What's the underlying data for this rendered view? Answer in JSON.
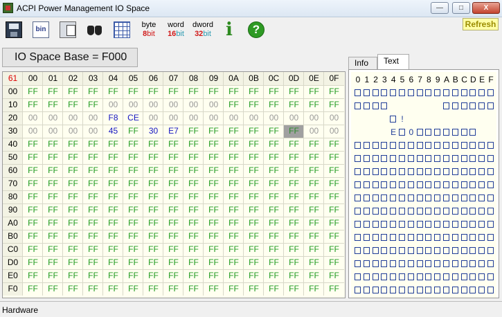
{
  "window": {
    "title": "ACPI Power Management IO Space",
    "minimize": "—",
    "maximize": "□",
    "close": "X"
  },
  "toolbar": {
    "bin_label": "bin",
    "byte": {
      "top": "byte",
      "num": "8",
      "unit": "bit"
    },
    "word": {
      "top": "word",
      "num": "16",
      "unit": "bit"
    },
    "dword": {
      "top": "dword",
      "num": "32",
      "unit": "bit"
    },
    "info_glyph": "i",
    "help_glyph": "?",
    "refresh": "Refresh"
  },
  "base_label": "IO Space Base = F000",
  "hex": {
    "corner": "61",
    "columns": [
      "00",
      "01",
      "02",
      "03",
      "04",
      "05",
      "06",
      "07",
      "08",
      "09",
      "0A",
      "0B",
      "0C",
      "0D",
      "0E",
      "0F"
    ],
    "rows": [
      {
        "addr": "00",
        "cells": [
          "FF",
          "FF",
          "FF",
          "FF",
          "FF",
          "FF",
          "FF",
          "FF",
          "FF",
          "FF",
          "FF",
          "FF",
          "FF",
          "FF",
          "FF",
          "FF"
        ]
      },
      {
        "addr": "10",
        "cells": [
          "FF",
          "FF",
          "FF",
          "FF",
          "00",
          "00",
          "00",
          "00",
          "00",
          "00",
          "FF",
          "FF",
          "FF",
          "FF",
          "FF",
          "FF"
        ]
      },
      {
        "addr": "20",
        "cells": [
          "00",
          "00",
          "00",
          "00",
          "F8",
          "CE",
          "00",
          "00",
          "00",
          "00",
          "00",
          "00",
          "00",
          "00",
          "00",
          "00"
        ]
      },
      {
        "addr": "30",
        "cells": [
          "00",
          "00",
          "00",
          "00",
          "45",
          "FF",
          "30",
          "E7",
          "FF",
          "FF",
          "FF",
          "FF",
          "FF",
          "FF",
          "00",
          "00"
        ]
      },
      {
        "addr": "40",
        "cells": [
          "FF",
          "FF",
          "FF",
          "FF",
          "FF",
          "FF",
          "FF",
          "FF",
          "FF",
          "FF",
          "FF",
          "FF",
          "FF",
          "FF",
          "FF",
          "FF"
        ]
      },
      {
        "addr": "50",
        "cells": [
          "FF",
          "FF",
          "FF",
          "FF",
          "FF",
          "FF",
          "FF",
          "FF",
          "FF",
          "FF",
          "FF",
          "FF",
          "FF",
          "FF",
          "FF",
          "FF"
        ]
      },
      {
        "addr": "60",
        "cells": [
          "FF",
          "FF",
          "FF",
          "FF",
          "FF",
          "FF",
          "FF",
          "FF",
          "FF",
          "FF",
          "FF",
          "FF",
          "FF",
          "FF",
          "FF",
          "FF"
        ]
      },
      {
        "addr": "70",
        "cells": [
          "FF",
          "FF",
          "FF",
          "FF",
          "FF",
          "FF",
          "FF",
          "FF",
          "FF",
          "FF",
          "FF",
          "FF",
          "FF",
          "FF",
          "FF",
          "FF"
        ]
      },
      {
        "addr": "80",
        "cells": [
          "FF",
          "FF",
          "FF",
          "FF",
          "FF",
          "FF",
          "FF",
          "FF",
          "FF",
          "FF",
          "FF",
          "FF",
          "FF",
          "FF",
          "FF",
          "FF"
        ]
      },
      {
        "addr": "90",
        "cells": [
          "FF",
          "FF",
          "FF",
          "FF",
          "FF",
          "FF",
          "FF",
          "FF",
          "FF",
          "FF",
          "FF",
          "FF",
          "FF",
          "FF",
          "FF",
          "FF"
        ]
      },
      {
        "addr": "A0",
        "cells": [
          "FF",
          "FF",
          "FF",
          "FF",
          "FF",
          "FF",
          "FF",
          "FF",
          "FF",
          "FF",
          "FF",
          "FF",
          "FF",
          "FF",
          "FF",
          "FF"
        ]
      },
      {
        "addr": "B0",
        "cells": [
          "FF",
          "FF",
          "FF",
          "FF",
          "FF",
          "FF",
          "FF",
          "FF",
          "FF",
          "FF",
          "FF",
          "FF",
          "FF",
          "FF",
          "FF",
          "FF"
        ]
      },
      {
        "addr": "C0",
        "cells": [
          "FF",
          "FF",
          "FF",
          "FF",
          "FF",
          "FF",
          "FF",
          "FF",
          "FF",
          "FF",
          "FF",
          "FF",
          "FF",
          "FF",
          "FF",
          "FF"
        ]
      },
      {
        "addr": "D0",
        "cells": [
          "FF",
          "FF",
          "FF",
          "FF",
          "FF",
          "FF",
          "FF",
          "FF",
          "FF",
          "FF",
          "FF",
          "FF",
          "FF",
          "FF",
          "FF",
          "FF"
        ]
      },
      {
        "addr": "E0",
        "cells": [
          "FF",
          "FF",
          "FF",
          "FF",
          "FF",
          "FF",
          "FF",
          "FF",
          "FF",
          "FF",
          "FF",
          "FF",
          "FF",
          "FF",
          "FF",
          "FF"
        ]
      },
      {
        "addr": "F0",
        "cells": [
          "FF",
          "FF",
          "FF",
          "FF",
          "FF",
          "FF",
          "FF",
          "FF",
          "FF",
          "FF",
          "FF",
          "FF",
          "FF",
          "FF",
          "FF",
          "FF"
        ]
      }
    ],
    "selected": "3D"
  },
  "tabs": [
    "Info",
    "Text"
  ],
  "active_tab": "Text",
  "text_panel": {
    "header": [
      "0",
      "1",
      "2",
      "3",
      "4",
      "5",
      "6",
      "7",
      "8",
      "9",
      "A",
      "B",
      "C",
      "D",
      "E",
      "F"
    ],
    "row_chars": {
      "2": {
        "5": "!"
      },
      "3": {
        "4": "E",
        "6": "0"
      }
    }
  },
  "status": "Hardware",
  "colors": {
    "ff": "#1f9a1f",
    "zero": "#999999",
    "other": "#1515c0",
    "selected_bg": "#a0a0a0"
  }
}
